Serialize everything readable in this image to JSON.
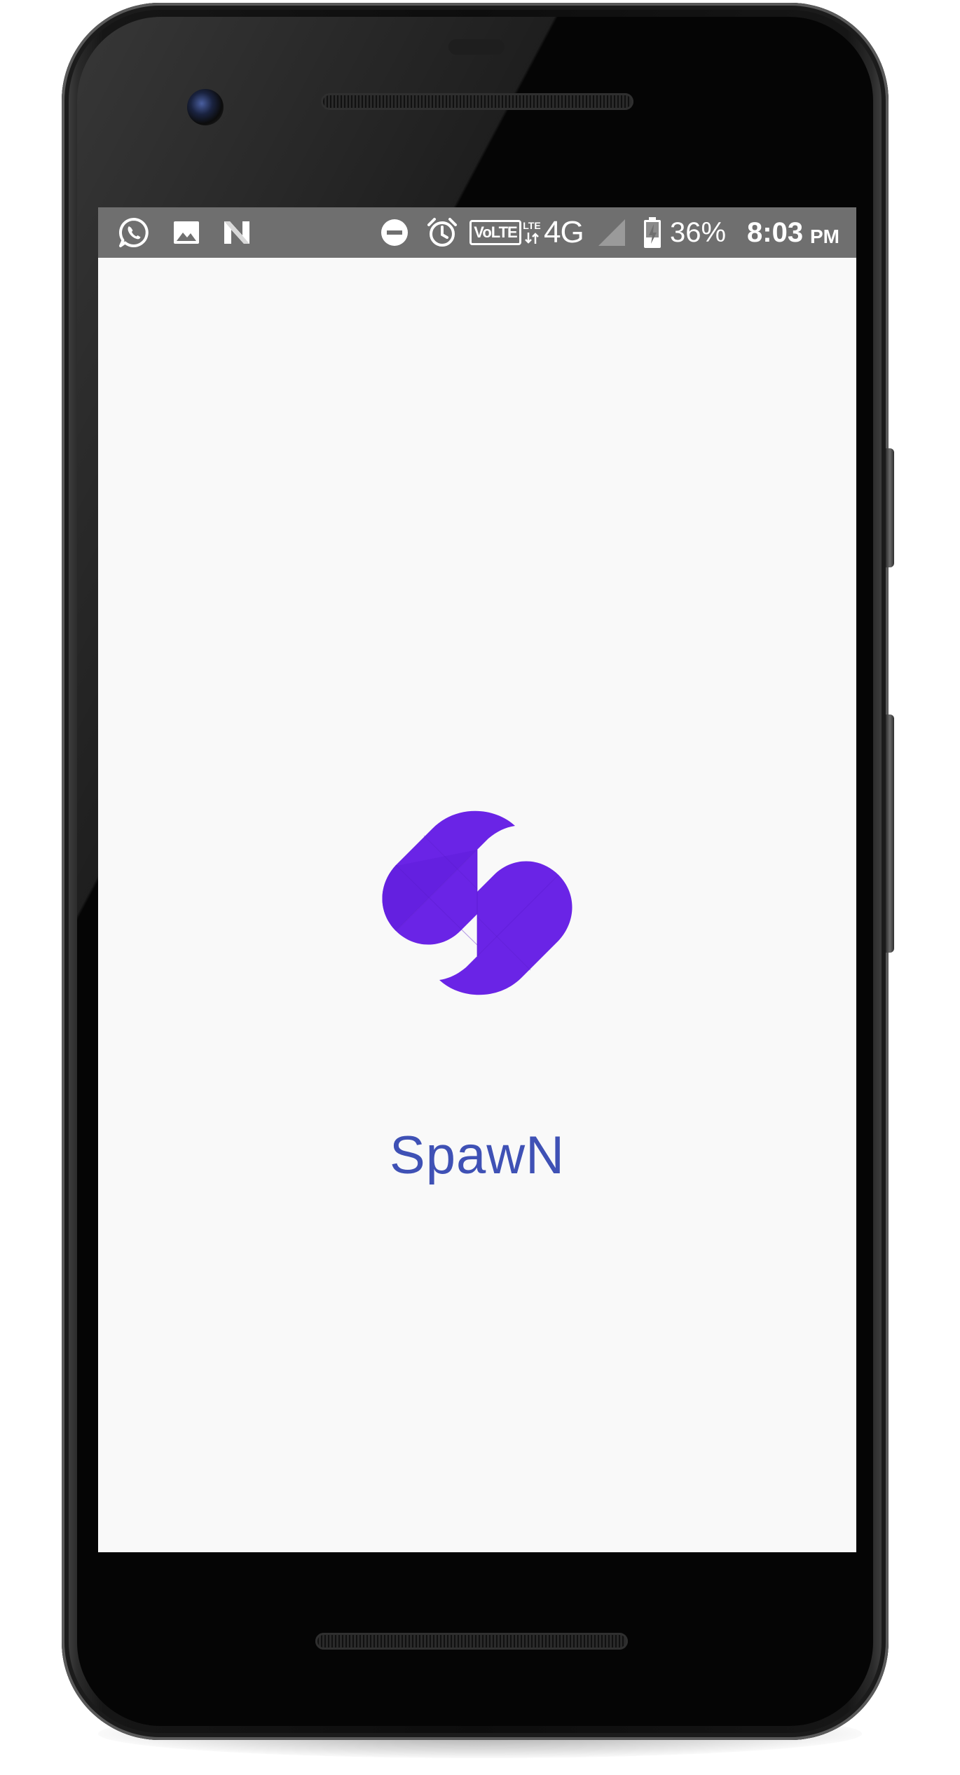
{
  "status_bar": {
    "left_icons": [
      "whatsapp-icon",
      "gallery-image-icon",
      "n-app-icon"
    ],
    "right_icons": [
      "do-not-disturb-icon",
      "alarm-clock-icon",
      "volte-icon",
      "lte-data-icon",
      "signal-strength-icon",
      "battery-charging-icon"
    ],
    "volte_label": "VoLTE",
    "lte_label": "LTE",
    "network": "4G",
    "battery_percent": "36%",
    "time": "8:03",
    "ampm": "PM"
  },
  "splash": {
    "logo_icon": "spawn-logo-icon",
    "app_name": "SpawN"
  },
  "colors": {
    "status_bar": "#6f6f6f",
    "screen_background": "#f9f9f9",
    "logo": "#6a24e6",
    "app_name": "#3f51b5"
  }
}
